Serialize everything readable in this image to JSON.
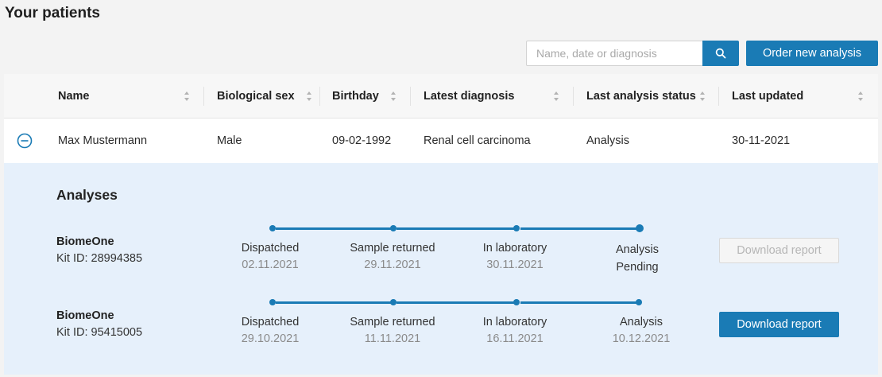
{
  "page": {
    "title": "Your patients"
  },
  "toolbar": {
    "search_placeholder": "Name, date or diagnosis",
    "search_value": "",
    "order_label": "Order new analysis"
  },
  "table": {
    "columns": [
      "Name",
      "Biological sex",
      "Birthday",
      "Latest diagnosis",
      "Last analysis status",
      "Last updated"
    ],
    "rows": [
      {
        "name": "Max Mustermann",
        "sex": "Male",
        "birthday": "09-02-1992",
        "diagnosis": "Renal cell carcinoma",
        "status": "Analysis",
        "updated": "30-11-2021"
      }
    ]
  },
  "analyses": {
    "title": "Analyses",
    "items": [
      {
        "kit_name": "BiomeOne",
        "kit_id": "Kit ID: 28994385",
        "steps": [
          {
            "label": "Dispatched",
            "date": "02.11.2021"
          },
          {
            "label": "Sample returned",
            "date": "29.11.2021"
          },
          {
            "label": "In laboratory",
            "date": "30.11.2021"
          },
          {
            "label": "Analysis",
            "date": "Pending"
          }
        ],
        "download_label": "Download report",
        "download_enabled": false
      },
      {
        "kit_name": "BiomeOne",
        "kit_id": "Kit ID: 95415005",
        "steps": [
          {
            "label": "Dispatched",
            "date": "29.10.2021"
          },
          {
            "label": "Sample returned",
            "date": "11.11.2021"
          },
          {
            "label": "In laboratory",
            "date": "16.11.2021"
          },
          {
            "label": "Analysis",
            "date": "10.12.2021"
          }
        ],
        "download_label": "Download report",
        "download_enabled": true
      }
    ]
  },
  "colors": {
    "accent": "#1a7bb5",
    "expanded_bg": "#e6f0fb"
  },
  "icons": {
    "search": "search-icon",
    "collapse": "minus-circle-icon",
    "sort": "sort-icon"
  }
}
